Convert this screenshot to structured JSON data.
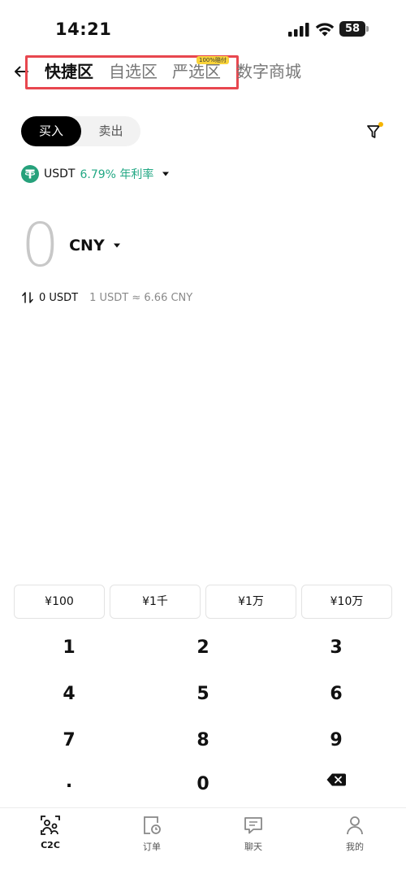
{
  "status_bar": {
    "time": "14:21",
    "battery": "58"
  },
  "header": {
    "tabs": [
      {
        "label": "快捷区",
        "active": true
      },
      {
        "label": "自选区",
        "active": false
      },
      {
        "label": "严选区",
        "active": false,
        "badge": "100%赔付"
      },
      {
        "label": "数字商城",
        "active": false
      }
    ]
  },
  "trade_toggle": {
    "buy_label": "买入",
    "sell_label": "卖出",
    "selected": "buy"
  },
  "coin": {
    "name": "USDT",
    "rate_text": "6.79% 年利率"
  },
  "amount": {
    "value": "0",
    "currency": "CNY"
  },
  "conversion": {
    "usdt_amount": "0 USDT",
    "rate": "1 USDT ≈ 6.66 CNY"
  },
  "quick_amounts": [
    "¥100",
    "¥1千",
    "¥1万",
    "¥10万"
  ],
  "keypad": {
    "rows": [
      [
        "1",
        "2",
        "3"
      ],
      [
        "4",
        "5",
        "6"
      ],
      [
        "7",
        "8",
        "9"
      ],
      [
        ".",
        "0",
        "backspace"
      ]
    ]
  },
  "bottom_nav": [
    {
      "label": "C2C",
      "icon": "c2c-people-icon",
      "active": true
    },
    {
      "label": "订单",
      "icon": "order-clock-icon",
      "active": false
    },
    {
      "label": "聊天",
      "icon": "chat-bubble-icon",
      "active": false
    },
    {
      "label": "我的",
      "icon": "profile-person-icon",
      "active": false
    }
  ],
  "colors": {
    "accent_green": "#22a884",
    "highlight_red": "#e8474f",
    "badge_yellow": "#f8d33b"
  }
}
